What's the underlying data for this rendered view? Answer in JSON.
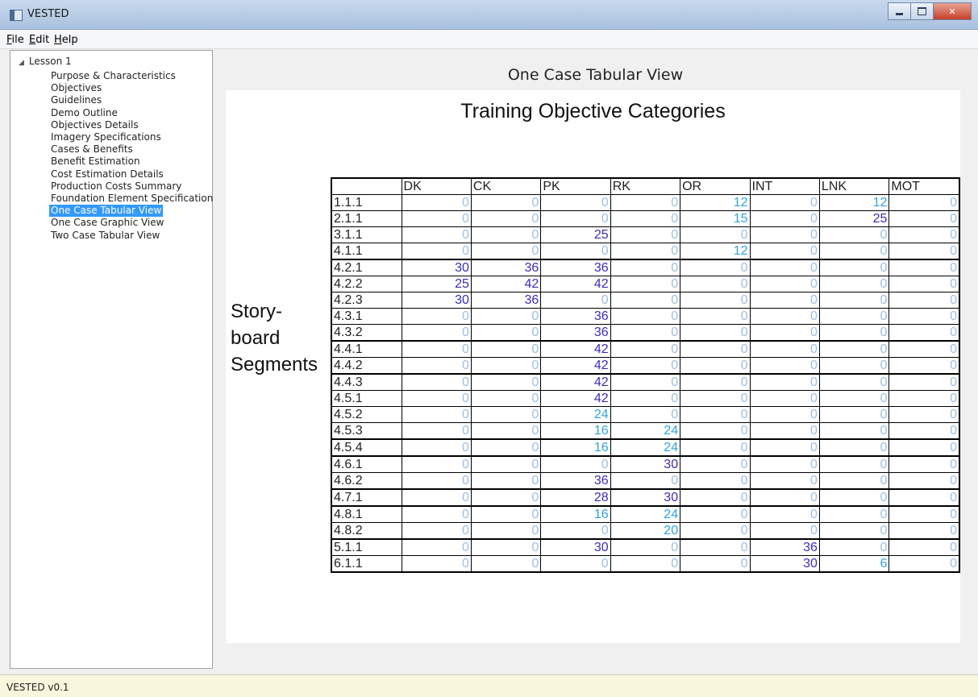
{
  "window": {
    "title": "VESTED"
  },
  "menu": [
    {
      "hot": "F",
      "rest": "ile"
    },
    {
      "hot": "E",
      "rest": "dit"
    },
    {
      "hot": "H",
      "rest": "elp"
    }
  ],
  "tree": {
    "root": "Lesson 1",
    "selected": "One Case Tabular View",
    "items": [
      "Purpose & Characteristics",
      "Objectives",
      "Guidelines",
      "Demo Outline",
      "Objectives Details",
      "Imagery Specifications",
      "Cases & Benefits",
      "Benefit Estimation",
      "Cost Estimation Details",
      "Production Costs Summary",
      "Foundation Element Specification",
      "One Case Tabular View",
      "One Case Graphic View",
      "Two Case Tabular View"
    ]
  },
  "view": {
    "title": "One Case Tabular View",
    "column_title": "Training Objective Categories",
    "row_title_lines": [
      "Story-",
      "board",
      "Segments"
    ]
  },
  "table": {
    "columns": [
      "DK",
      "CK",
      "PK",
      "RK",
      "OR",
      "INT",
      "LNK",
      "MOT"
    ],
    "rows": [
      {
        "label": "1.1.1",
        "values": [
          0,
          0,
          0,
          0,
          12,
          0,
          12,
          0
        ]
      },
      {
        "label": "2.1.1",
        "values": [
          0,
          0,
          0,
          0,
          15,
          0,
          25,
          0
        ]
      },
      {
        "label": "3.1.1",
        "values": [
          0,
          0,
          25,
          0,
          0,
          0,
          0,
          0
        ]
      },
      {
        "label": "4.1.1",
        "values": [
          0,
          0,
          0,
          0,
          12,
          0,
          0,
          0
        ]
      },
      {
        "label": "4.2.1",
        "values": [
          30,
          36,
          36,
          0,
          0,
          0,
          0,
          0
        ]
      },
      {
        "label": "4.2.2",
        "values": [
          25,
          42,
          42,
          0,
          0,
          0,
          0,
          0
        ]
      },
      {
        "label": "4.2.3",
        "values": [
          30,
          36,
          0,
          0,
          0,
          0,
          0,
          0
        ]
      },
      {
        "label": "4.3.1",
        "values": [
          0,
          0,
          36,
          0,
          0,
          0,
          0,
          0
        ]
      },
      {
        "label": "4.3.2",
        "values": [
          0,
          0,
          36,
          0,
          0,
          0,
          0,
          0
        ]
      },
      {
        "label": "4.4.1",
        "values": [
          0,
          0,
          42,
          0,
          0,
          0,
          0,
          0
        ]
      },
      {
        "label": "4.4.2",
        "values": [
          0,
          0,
          42,
          0,
          0,
          0,
          0,
          0
        ]
      },
      {
        "label": "4.4.3",
        "values": [
          0,
          0,
          42,
          0,
          0,
          0,
          0,
          0
        ]
      },
      {
        "label": "4.5.1",
        "values": [
          0,
          0,
          42,
          0,
          0,
          0,
          0,
          0
        ]
      },
      {
        "label": "4.5.2",
        "values": [
          0,
          0,
          24,
          0,
          0,
          0,
          0,
          0
        ]
      },
      {
        "label": "4.5.3",
        "values": [
          0,
          0,
          16,
          24,
          0,
          0,
          0,
          0
        ]
      },
      {
        "label": "4.5.4",
        "values": [
          0,
          0,
          16,
          24,
          0,
          0,
          0,
          0
        ]
      },
      {
        "label": "4.6.1",
        "values": [
          0,
          0,
          0,
          30,
          0,
          0,
          0,
          0
        ]
      },
      {
        "label": "4.6.2",
        "values": [
          0,
          0,
          36,
          0,
          0,
          0,
          0,
          0
        ]
      },
      {
        "label": "4.7.1",
        "values": [
          0,
          0,
          28,
          30,
          0,
          0,
          0,
          0
        ]
      },
      {
        "label": "4.8.1",
        "values": [
          0,
          0,
          16,
          24,
          0,
          0,
          0,
          0
        ]
      },
      {
        "label": "4.8.2",
        "values": [
          0,
          0,
          0,
          20,
          0,
          0,
          0,
          0
        ]
      },
      {
        "label": "5.1.1",
        "values": [
          0,
          0,
          30,
          0,
          0,
          36,
          0,
          0
        ]
      },
      {
        "label": "6.1.1",
        "values": [
          0,
          0,
          0,
          0,
          0,
          30,
          6,
          0
        ]
      }
    ]
  },
  "status": {
    "text": "VESTED v0.1"
  },
  "colors": {
    "zero": "#9cc0e8",
    "low": "#2ea3e6",
    "high": "#3a2bc2",
    "selection": "#3399ff"
  }
}
